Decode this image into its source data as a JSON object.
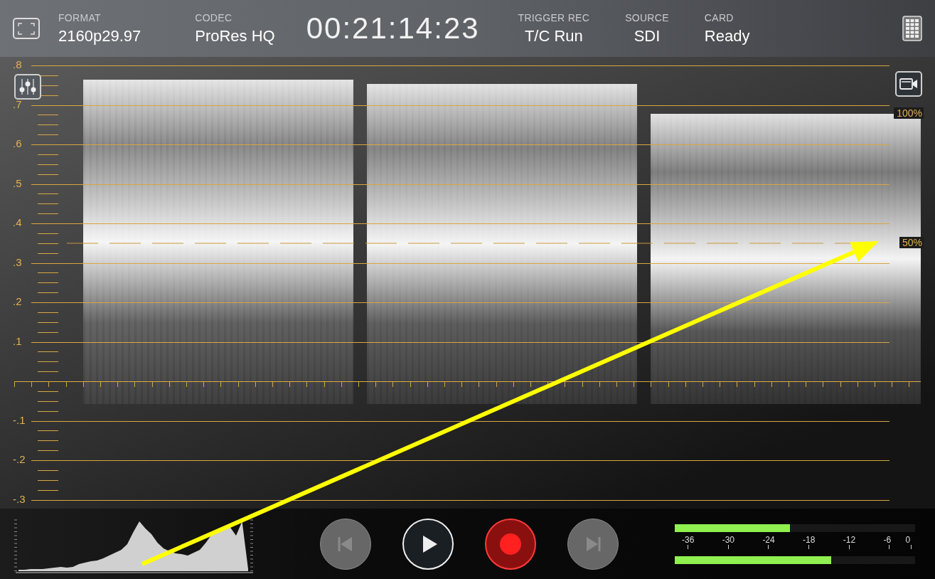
{
  "top_bar": {
    "fields": [
      {
        "label": "FORMAT",
        "value": "2160p29.97"
      },
      {
        "label": "CODEC",
        "value": "ProRes HQ"
      },
      {
        "kind": "timecode",
        "value": "00:21:14:23"
      },
      {
        "label": "TRIGGER REC",
        "value": "T/C Run"
      },
      {
        "label": "SOURCE",
        "value": "SDI"
      },
      {
        "label": "CARD",
        "value": "Ready"
      }
    ]
  },
  "scope": {
    "scale": [
      ".8",
      ".7",
      ".6",
      ".5",
      ".4",
      ".3",
      ".2",
      ".1",
      "-.1",
      "-.2",
      "-.3"
    ],
    "ref_high": "100%",
    "ref_mid": "50%"
  },
  "transport": [
    {
      "kind": "prev",
      "disabled": true
    },
    {
      "kind": "play",
      "disabled": false
    },
    {
      "kind": "record",
      "disabled": false
    },
    {
      "kind": "next",
      "disabled": true
    }
  ],
  "audio_meter": {
    "channels": [
      {
        "level": 0.48
      },
      {
        "level": 0.65
      }
    ],
    "scale": [
      "-36",
      "-30",
      "-24",
      "-18",
      "-12",
      "-6",
      "0"
    ]
  }
}
